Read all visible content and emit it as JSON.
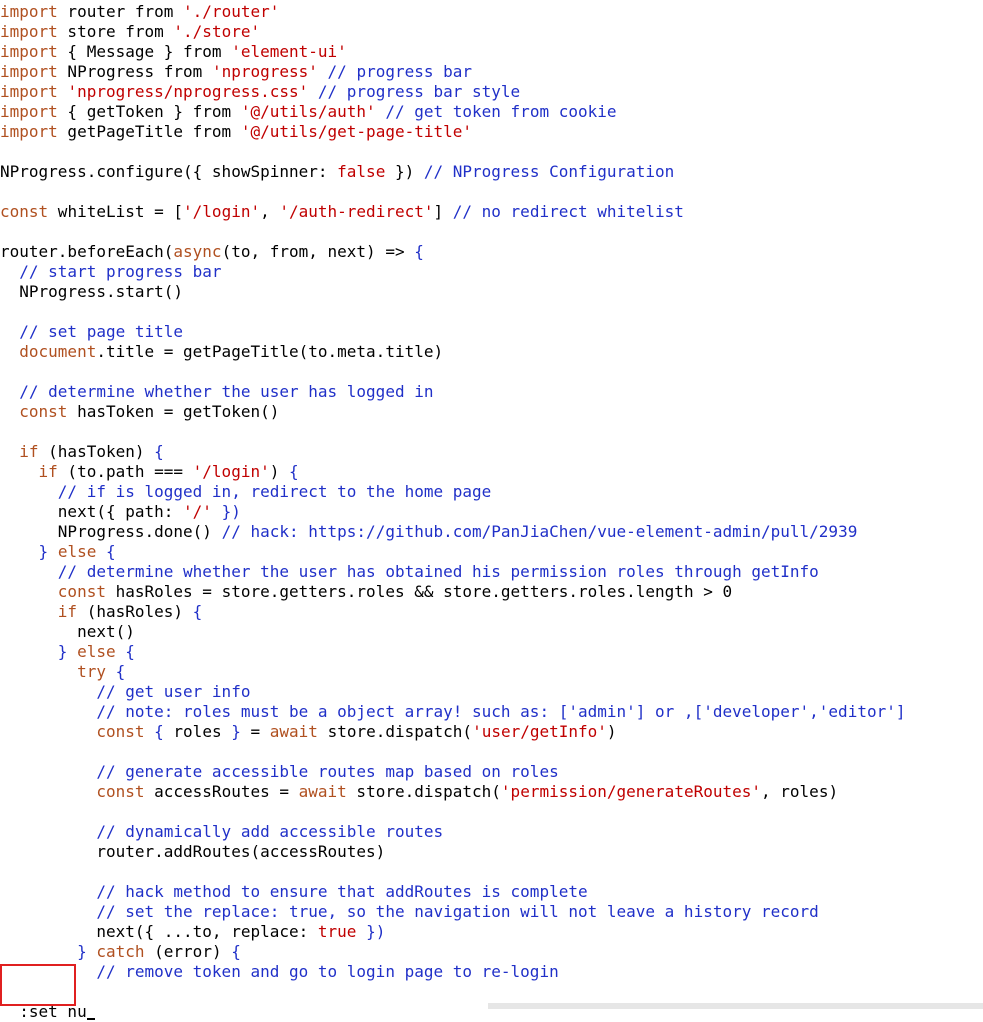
{
  "colors": {
    "keyword": "#b05020",
    "string": "#c00000",
    "comment": "#2030c8",
    "punctuation": "#2030c8",
    "text": "#000000",
    "highlight_border": "#e02020"
  },
  "code_lines": [
    [
      {
        "t": "kw",
        "v": "import"
      },
      {
        "t": "plain",
        "v": " router "
      },
      {
        "t": "plain",
        "v": "from"
      },
      {
        "t": "plain",
        "v": " "
      },
      {
        "t": "str",
        "v": "'./router'"
      }
    ],
    [
      {
        "t": "kw",
        "v": "import"
      },
      {
        "t": "plain",
        "v": " store "
      },
      {
        "t": "plain",
        "v": "from"
      },
      {
        "t": "plain",
        "v": " "
      },
      {
        "t": "str",
        "v": "'./store'"
      }
    ],
    [
      {
        "t": "kw",
        "v": "import"
      },
      {
        "t": "plain",
        "v": " { Message } "
      },
      {
        "t": "plain",
        "v": "from"
      },
      {
        "t": "plain",
        "v": " "
      },
      {
        "t": "str",
        "v": "'element-ui'"
      }
    ],
    [
      {
        "t": "kw",
        "v": "import"
      },
      {
        "t": "plain",
        "v": " NProgress "
      },
      {
        "t": "plain",
        "v": "from"
      },
      {
        "t": "plain",
        "v": " "
      },
      {
        "t": "str",
        "v": "'nprogress'"
      },
      {
        "t": "cm",
        "v": " // progress bar"
      }
    ],
    [
      {
        "t": "kw",
        "v": "import"
      },
      {
        "t": "plain",
        "v": " "
      },
      {
        "t": "str",
        "v": "'nprogress/nprogress.css'"
      },
      {
        "t": "cm",
        "v": " // progress bar style"
      }
    ],
    [
      {
        "t": "kw",
        "v": "import"
      },
      {
        "t": "plain",
        "v": " { getToken } "
      },
      {
        "t": "plain",
        "v": "from"
      },
      {
        "t": "plain",
        "v": " "
      },
      {
        "t": "str",
        "v": "'@/utils/auth'"
      },
      {
        "t": "cm",
        "v": " // get token from cookie"
      }
    ],
    [
      {
        "t": "kw",
        "v": "import"
      },
      {
        "t": "plain",
        "v": " getPageTitle "
      },
      {
        "t": "plain",
        "v": "from"
      },
      {
        "t": "plain",
        "v": " "
      },
      {
        "t": "str",
        "v": "'@/utils/get-page-title'"
      }
    ],
    [],
    [
      {
        "t": "plain",
        "v": "NProgress.configure({ showSpinner: "
      },
      {
        "t": "str",
        "v": "false"
      },
      {
        "t": "plain",
        "v": " }) "
      },
      {
        "t": "cm",
        "v": "// NProgress Configuration"
      }
    ],
    [],
    [
      {
        "t": "kw",
        "v": "const"
      },
      {
        "t": "plain",
        "v": " whiteList = ["
      },
      {
        "t": "str",
        "v": "'/login'"
      },
      {
        "t": "plain",
        "v": ", "
      },
      {
        "t": "str",
        "v": "'/auth-redirect'"
      },
      {
        "t": "plain",
        "v": "] "
      },
      {
        "t": "cm",
        "v": "// no redirect whitelist"
      }
    ],
    [],
    [
      {
        "t": "plain",
        "v": "router.beforeEach("
      },
      {
        "t": "kw",
        "v": "async"
      },
      {
        "t": "plain",
        "v": "(to, from, next) => "
      },
      {
        "t": "pn",
        "v": "{"
      }
    ],
    [
      {
        "t": "cm",
        "v": "  // start progress bar"
      }
    ],
    [
      {
        "t": "plain",
        "v": "  NProgress.start()"
      }
    ],
    [],
    [
      {
        "t": "cm",
        "v": "  // set page title"
      }
    ],
    [
      {
        "t": "plain",
        "v": "  "
      },
      {
        "t": "kw",
        "v": "document"
      },
      {
        "t": "plain",
        "v": ".title = getPageTitle(to.meta.title)"
      }
    ],
    [],
    [
      {
        "t": "cm",
        "v": "  // determine whether the user has logged in"
      }
    ],
    [
      {
        "t": "plain",
        "v": "  "
      },
      {
        "t": "kw",
        "v": "const"
      },
      {
        "t": "plain",
        "v": " hasToken = getToken()"
      }
    ],
    [],
    [
      {
        "t": "plain",
        "v": "  "
      },
      {
        "t": "kw",
        "v": "if"
      },
      {
        "t": "plain",
        "v": " (hasToken) "
      },
      {
        "t": "pn",
        "v": "{"
      }
    ],
    [
      {
        "t": "plain",
        "v": "    "
      },
      {
        "t": "kw",
        "v": "if"
      },
      {
        "t": "plain",
        "v": " (to.path === "
      },
      {
        "t": "str",
        "v": "'/login'"
      },
      {
        "t": "plain",
        "v": ") "
      },
      {
        "t": "pn",
        "v": "{"
      }
    ],
    [
      {
        "t": "cm",
        "v": "      // if is logged in, redirect to the home page"
      }
    ],
    [
      {
        "t": "plain",
        "v": "      next({ path: "
      },
      {
        "t": "str",
        "v": "'/'"
      },
      {
        "t": "plain",
        "v": " "
      },
      {
        "t": "pn",
        "v": "})"
      }
    ],
    [
      {
        "t": "plain",
        "v": "      NProgress.done() "
      },
      {
        "t": "cm",
        "v": "// hack: https://github.com/PanJiaChen/vue-element-admin/pull/2939"
      }
    ],
    [
      {
        "t": "pn",
        "v": "    }"
      },
      {
        "t": "plain",
        "v": " "
      },
      {
        "t": "kw",
        "v": "else"
      },
      {
        "t": "plain",
        "v": " "
      },
      {
        "t": "pn",
        "v": "{"
      }
    ],
    [
      {
        "t": "cm",
        "v": "      // determine whether the user has obtained his permission roles through getInfo"
      }
    ],
    [
      {
        "t": "plain",
        "v": "      "
      },
      {
        "t": "kw",
        "v": "const"
      },
      {
        "t": "plain",
        "v": " hasRoles = store.getters.roles && store.getters.roles.length > 0"
      }
    ],
    [
      {
        "t": "plain",
        "v": "      "
      },
      {
        "t": "kw",
        "v": "if"
      },
      {
        "t": "plain",
        "v": " (hasRoles) "
      },
      {
        "t": "pn",
        "v": "{"
      }
    ],
    [
      {
        "t": "plain",
        "v": "        next()"
      }
    ],
    [
      {
        "t": "pn",
        "v": "      }"
      },
      {
        "t": "plain",
        "v": " "
      },
      {
        "t": "kw",
        "v": "else"
      },
      {
        "t": "plain",
        "v": " "
      },
      {
        "t": "pn",
        "v": "{"
      }
    ],
    [
      {
        "t": "plain",
        "v": "        "
      },
      {
        "t": "kw",
        "v": "try"
      },
      {
        "t": "plain",
        "v": " "
      },
      {
        "t": "pn",
        "v": "{"
      }
    ],
    [
      {
        "t": "cm",
        "v": "          // get user info"
      }
    ],
    [
      {
        "t": "cm",
        "v": "          // note: roles must be a object array! such as: ['admin'] or ,['developer','editor']"
      }
    ],
    [
      {
        "t": "plain",
        "v": "          "
      },
      {
        "t": "kw",
        "v": "const"
      },
      {
        "t": "plain",
        "v": " "
      },
      {
        "t": "pn",
        "v": "{"
      },
      {
        "t": "plain",
        "v": " roles "
      },
      {
        "t": "pn",
        "v": "}"
      },
      {
        "t": "plain",
        "v": " = "
      },
      {
        "t": "kw",
        "v": "await"
      },
      {
        "t": "plain",
        "v": " store.dispatch("
      },
      {
        "t": "str",
        "v": "'user/getInfo'"
      },
      {
        "t": "plain",
        "v": ")"
      }
    ],
    [],
    [
      {
        "t": "cm",
        "v": "          // generate accessible routes map based on roles"
      }
    ],
    [
      {
        "t": "plain",
        "v": "          "
      },
      {
        "t": "kw",
        "v": "const"
      },
      {
        "t": "plain",
        "v": " accessRoutes = "
      },
      {
        "t": "kw",
        "v": "await"
      },
      {
        "t": "plain",
        "v": " store.dispatch("
      },
      {
        "t": "str",
        "v": "'permission/generateRoutes'"
      },
      {
        "t": "plain",
        "v": ", roles)"
      }
    ],
    [],
    [
      {
        "t": "cm",
        "v": "          // dynamically add accessible routes"
      }
    ],
    [
      {
        "t": "plain",
        "v": "          router.addRoutes(accessRoutes)"
      }
    ],
    [],
    [
      {
        "t": "cm",
        "v": "          // hack method to ensure that addRoutes is complete"
      }
    ],
    [
      {
        "t": "cm",
        "v": "          // set the replace: true, so the navigation will not leave a history record"
      }
    ],
    [
      {
        "t": "plain",
        "v": "          next({ ...to, replace: "
      },
      {
        "t": "str",
        "v": "true"
      },
      {
        "t": "plain",
        "v": " "
      },
      {
        "t": "pn",
        "v": "})"
      }
    ],
    [
      {
        "t": "pn",
        "v": "        }"
      },
      {
        "t": "plain",
        "v": " "
      },
      {
        "t": "kw",
        "v": "catch"
      },
      {
        "t": "plain",
        "v": " (error) "
      },
      {
        "t": "pn",
        "v": "{"
      }
    ],
    [
      {
        "t": "cm",
        "v": "          // remove token and go to login page to re-login"
      }
    ]
  ],
  "command_line": {
    "text": ":set nu"
  }
}
